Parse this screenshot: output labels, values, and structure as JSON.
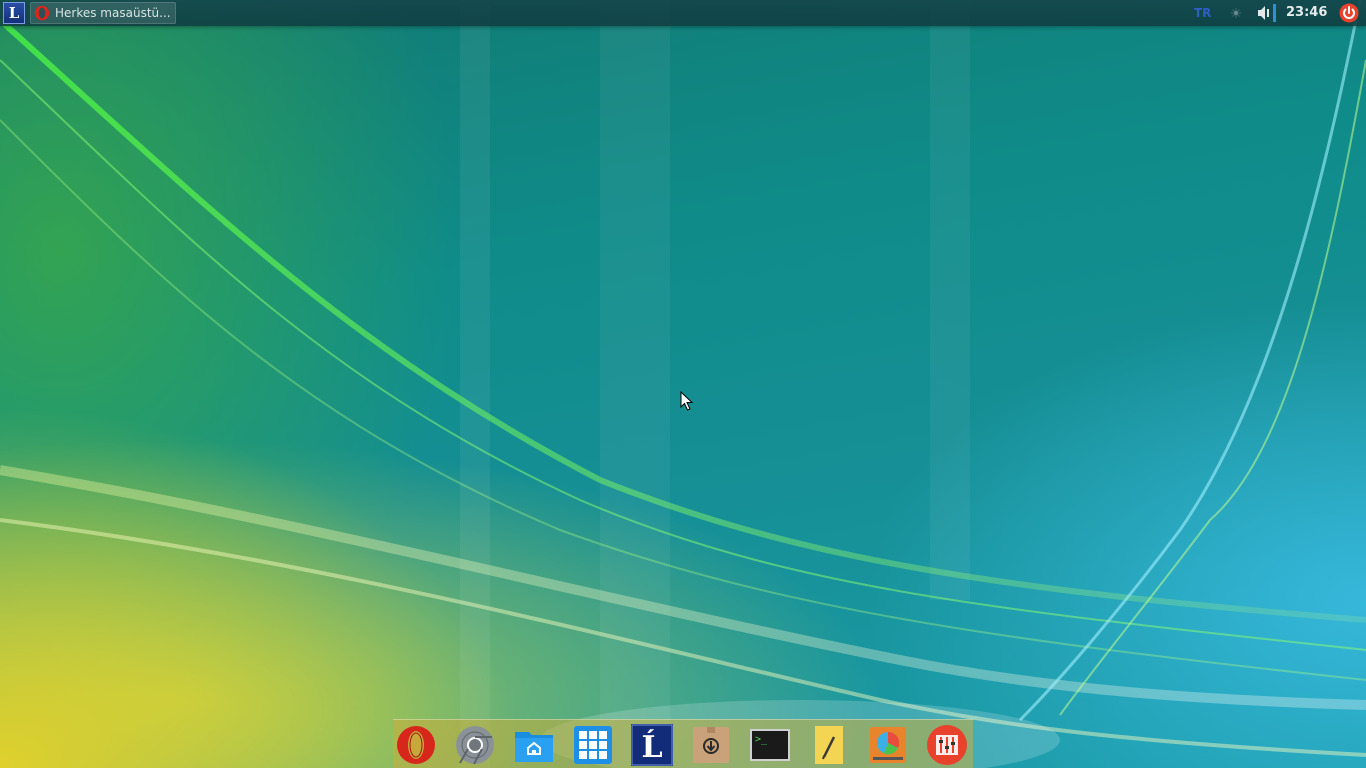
{
  "desktop": {
    "wallpaper": "aurora-wave-wallpaper"
  },
  "top_panel": {
    "start_button": {
      "glyph": "L",
      "icon": "start-menu-logo"
    },
    "taskbar_item": {
      "label": "Herkes masaüstü...",
      "icon": "opera-icon"
    },
    "tray": {
      "keyboard_layout": "TR",
      "network_icon": "network-icon",
      "volume_icon": "volume-icon",
      "clock": "23:46",
      "power_icon": "power-icon"
    }
  },
  "dock": {
    "items": [
      {
        "name": "opera",
        "icon": "opera-icon"
      },
      {
        "name": "chrome",
        "icon": "chrome-icon"
      },
      {
        "name": "file-manager",
        "icon": "folder-home-icon"
      },
      {
        "name": "app-grid",
        "icon": "app-grid-icon"
      },
      {
        "name": "distro-logo",
        "icon": "distro-logo-icon",
        "glyph": "Ĺ"
      },
      {
        "name": "package-installer",
        "icon": "package-install-icon"
      },
      {
        "name": "terminal",
        "icon": "terminal-icon",
        "glyph": ">_"
      },
      {
        "name": "text-editor",
        "icon": "text-editor-icon"
      },
      {
        "name": "disk-usage",
        "icon": "disk-usage-icon"
      },
      {
        "name": "settings-mixer",
        "icon": "mixer-icon"
      }
    ]
  },
  "colors": {
    "panel_bg": "#144a4f",
    "accent_blue": "#2f5ec2",
    "power_red": "#e8412c",
    "opera_red": "#d7261c"
  }
}
